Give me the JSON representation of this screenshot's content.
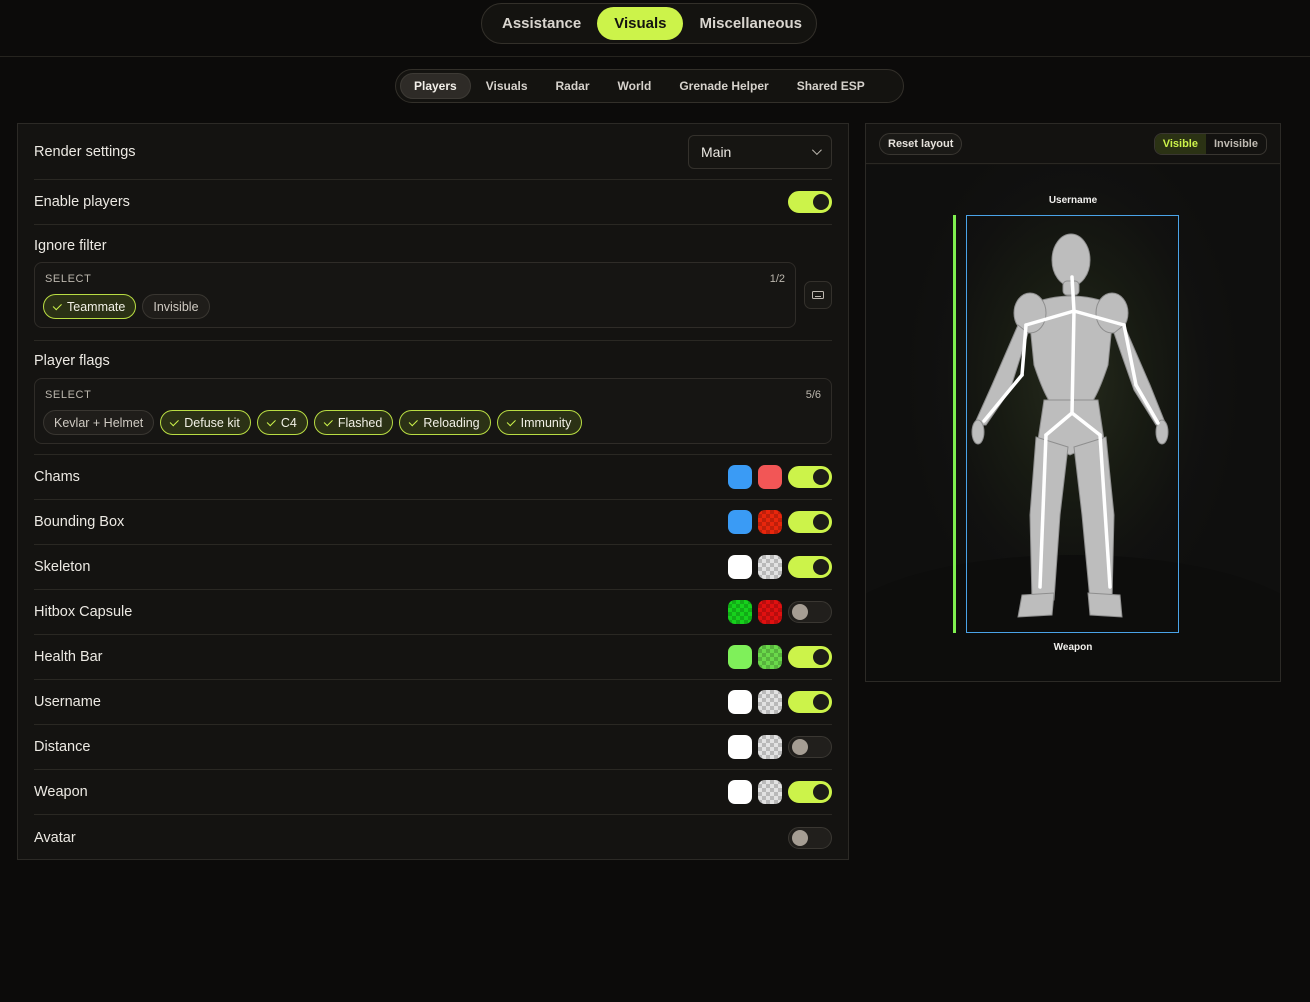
{
  "top_nav": {
    "tabs": [
      {
        "label": "Assistance",
        "active": false
      },
      {
        "label": "Visuals",
        "active": true
      },
      {
        "label": "Miscellaneous",
        "active": false
      }
    ]
  },
  "sub_nav": {
    "tabs": [
      {
        "label": "Players",
        "active": true
      },
      {
        "label": "Visuals",
        "active": false
      },
      {
        "label": "Radar",
        "active": false
      },
      {
        "label": "World",
        "active": false
      },
      {
        "label": "Grenade Helper",
        "active": false
      },
      {
        "label": "Shared ESP",
        "active": false
      }
    ]
  },
  "settings": {
    "render_settings": {
      "label": "Render settings",
      "value": "Main",
      "icon": "chevron-down-icon"
    },
    "enable_players": {
      "label": "Enable players",
      "on": true
    },
    "ignore_filter": {
      "label": "Ignore filter",
      "select_title": "SELECT",
      "count": "1/2",
      "options": [
        {
          "label": "Teammate",
          "checked": true
        },
        {
          "label": "Invisible",
          "checked": false
        }
      ],
      "keybind_icon": "keyboard-icon"
    },
    "player_flags": {
      "label": "Player flags",
      "select_title": "SELECT",
      "count": "5/6",
      "options": [
        {
          "label": "Kevlar + Helmet",
          "checked": false
        },
        {
          "label": "Defuse kit",
          "checked": true
        },
        {
          "label": "C4",
          "checked": true
        },
        {
          "label": "Flashed",
          "checked": true
        },
        {
          "label": "Reloading",
          "checked": true
        },
        {
          "label": "Immunity",
          "checked": true
        }
      ]
    },
    "features": [
      {
        "label": "Chams",
        "colors": [
          "#3a9bf5",
          "#f25656"
        ],
        "on": true
      },
      {
        "label": "Bounding Box",
        "colors": [
          "#3a9bf5",
          "#e8260c"
        ],
        "on": true
      },
      {
        "label": "Skeleton",
        "colors": [
          "#ffffff",
          "#e2e2e2"
        ],
        "on": true
      },
      {
        "label": "Hitbox Capsule",
        "colors": [
          "#16d11c",
          "#e01010"
        ],
        "on": false
      },
      {
        "label": "Health Bar",
        "colors": [
          "#7ff05a",
          "#6ad94a"
        ],
        "on": true
      },
      {
        "label": "Username",
        "colors": [
          "#ffffff",
          "#e2e2e2"
        ],
        "on": true
      },
      {
        "label": "Distance",
        "colors": [
          "#ffffff",
          "#e2e2e2"
        ],
        "on": false
      },
      {
        "label": "Weapon",
        "colors": [
          "#ffffff",
          "#e2e2e2"
        ],
        "on": true
      },
      {
        "label": "Avatar",
        "colors": [],
        "on": false
      }
    ]
  },
  "preview": {
    "reset_label": "Reset layout",
    "visibility": [
      {
        "label": "Visible",
        "active": true
      },
      {
        "label": "Invisible",
        "active": false
      }
    ],
    "username_label": "Username",
    "weapon_label": "Weapon",
    "health": 1.0,
    "accent": "#ccf34a",
    "box_color": "#4aa3e8",
    "health_color": "#7ff04f"
  }
}
